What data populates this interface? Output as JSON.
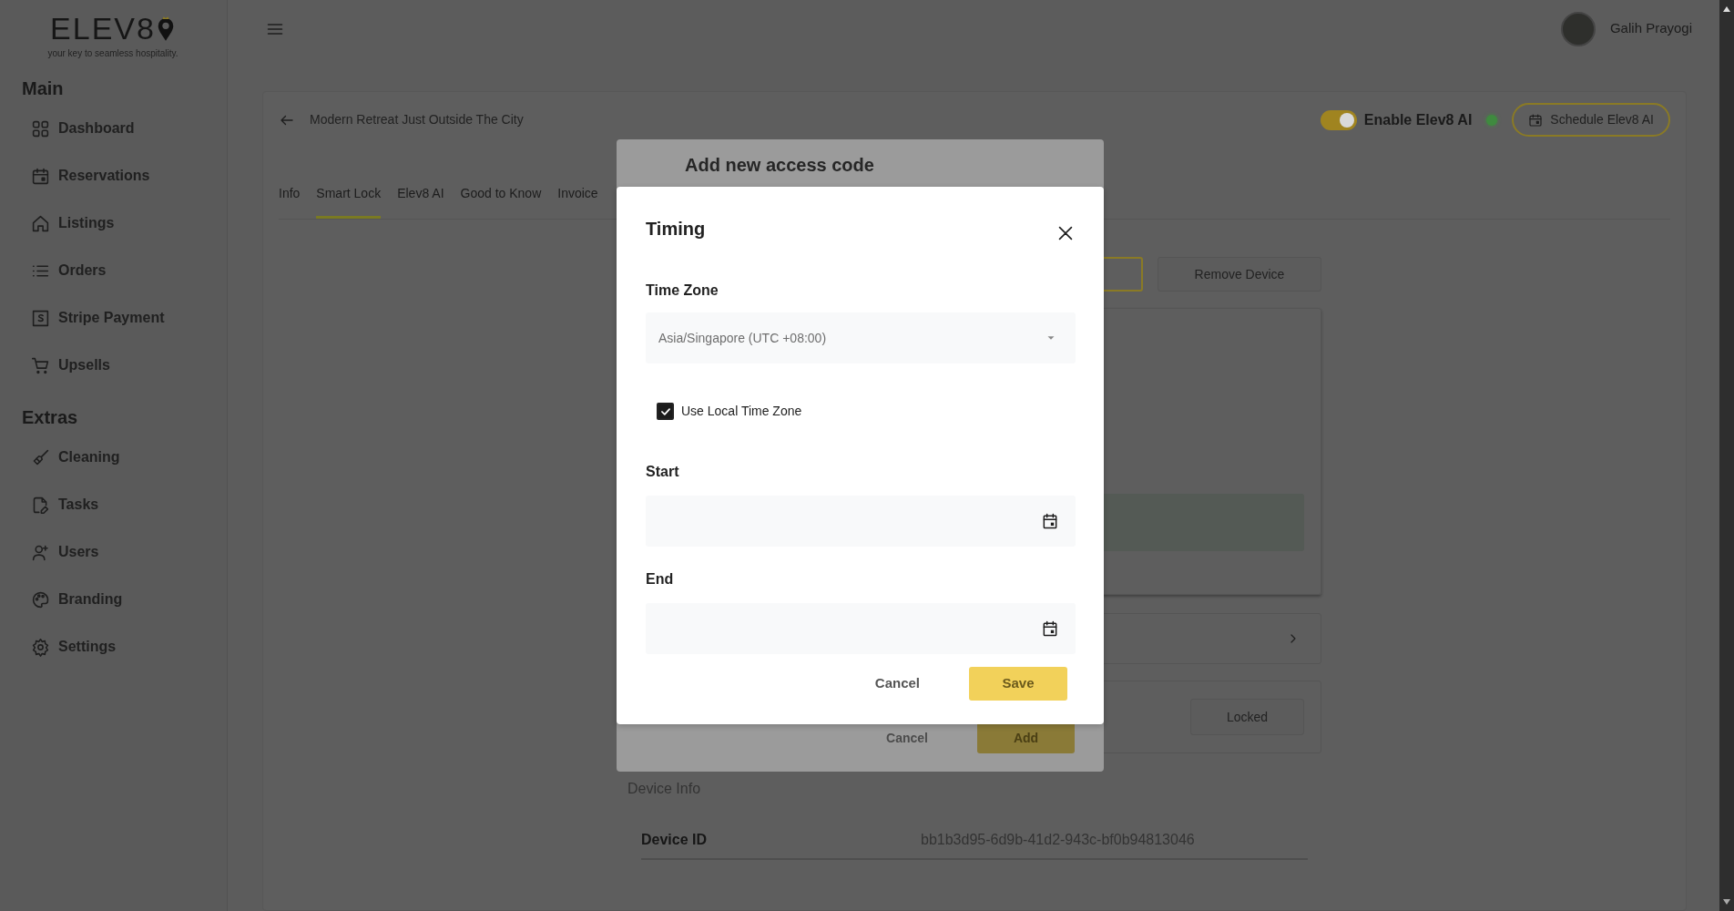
{
  "brand": {
    "name": "ELEV8",
    "tagline": "your key to seamless hospitality."
  },
  "sidebar": {
    "sections": [
      {
        "title": "Main",
        "items": [
          {
            "label": "Dashboard",
            "kind": "dashboard"
          },
          {
            "label": "Reservations",
            "kind": "calendar"
          },
          {
            "label": "Listings",
            "kind": "house"
          },
          {
            "label": "Orders",
            "kind": "list"
          },
          {
            "label": "Stripe Payment",
            "kind": "stripe"
          },
          {
            "label": "Upsells",
            "kind": "cart"
          }
        ]
      },
      {
        "title": "Extras",
        "items": [
          {
            "label": "Cleaning",
            "kind": "broom"
          },
          {
            "label": "Tasks",
            "kind": "file"
          },
          {
            "label": "Users",
            "kind": "user"
          },
          {
            "label": "Branding",
            "kind": "palette"
          },
          {
            "label": "Settings",
            "kind": "gear"
          }
        ]
      }
    ]
  },
  "user": {
    "name": "Galih Prayogi"
  },
  "listing": {
    "title": "Modern Retreat Just Outside The City"
  },
  "ai": {
    "label": "Enable Elev8 AI",
    "on": true,
    "active": true,
    "schedule_button": "Schedule Elev8 AI"
  },
  "tabs": [
    {
      "label": "Info",
      "selected": false
    },
    {
      "label": "Smart Lock",
      "selected": true
    },
    {
      "label": "Elev8 AI",
      "selected": false
    },
    {
      "label": "Good to Know",
      "selected": false
    },
    {
      "label": "Invoice",
      "selected": false
    }
  ],
  "device": {
    "remove_button": "Remove Device",
    "lock_status": "Locked",
    "info_title": "Device Info",
    "rows": [
      {
        "label": "Device ID",
        "value": "bb1b3d95-6d9b-41d2-943c-bf0b94813046"
      }
    ]
  },
  "access_modal": {
    "title": "Add new access code",
    "buttons": [
      {
        "label": "Cancel",
        "kind": "secondary"
      },
      {
        "label": "Add",
        "kind": "primary"
      }
    ]
  },
  "timing_modal": {
    "title": "Timing",
    "time_zone": {
      "label": "Time Zone",
      "value": "Asia/Singapore (UTC +08:00)",
      "disabled": true
    },
    "use_local": {
      "label": "Use Local Time Zone",
      "checked": true
    },
    "start": {
      "label": "Start"
    },
    "end": {
      "label": "End"
    },
    "buttons": [
      {
        "label": "Cancel",
        "kind": "secondary"
      },
      {
        "label": "Save",
        "kind": "primary"
      }
    ]
  }
}
